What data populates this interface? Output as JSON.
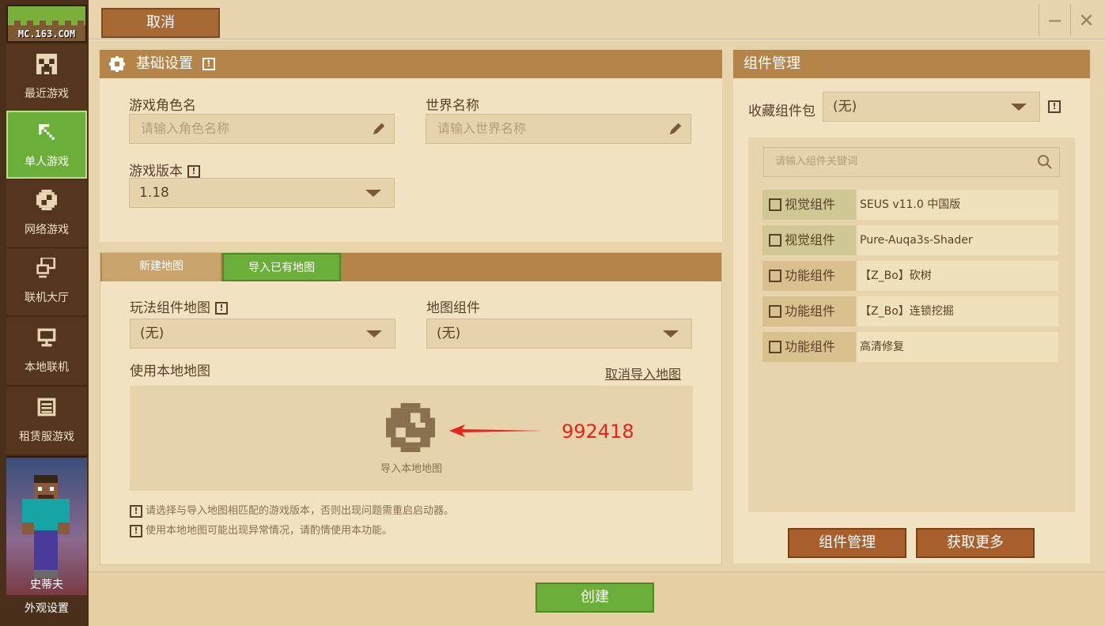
{
  "logo": {
    "text": "MC.163.COM"
  },
  "sidebar": {
    "items": [
      {
        "label": "最近游戏",
        "icon": "creeper-icon"
      },
      {
        "label": "单人游戏",
        "icon": "pickaxe-icon",
        "active": true
      },
      {
        "label": "网络游戏",
        "icon": "globe-icon"
      },
      {
        "label": "联机大厅",
        "icon": "network-icon"
      },
      {
        "label": "本地联机",
        "icon": "monitor-icon"
      },
      {
        "label": "租赁服游戏",
        "icon": "server-list-icon"
      }
    ],
    "avatar_name": "史蒂夫",
    "appearance_label": "外观设置"
  },
  "topbar": {
    "cancel_label": "取消",
    "minimize": "−",
    "close": "✕"
  },
  "basic": {
    "title": "基础设置",
    "info_mark": "!",
    "role_label": "游戏角色名",
    "role_placeholder": "请输入角色名称",
    "world_label": "世界名称",
    "world_placeholder": "请输入世界名称",
    "version_label": "游戏版本",
    "version_value": "1.18"
  },
  "map": {
    "tab_new": "新建地图",
    "tab_import": "导入已有地图",
    "gameplay_label": "玩法组件地图",
    "gameplay_value": "(无)",
    "mapcomp_label": "地图组件",
    "mapcomp_value": "(无)",
    "local_label": "使用本地地图",
    "cancel_import": "取消导入地图",
    "import_local": "导入本地地图",
    "annotation": "992418",
    "tip1": "请选择与导入地图相匹配的游戏版本，否则出现问题需重启启动器。",
    "tip2": "使用本地地图可能出现异常情况，请酌情使用本功能。"
  },
  "components": {
    "title": "组件管理",
    "fav_label": "收藏组件包",
    "fav_value": "(无)",
    "search_placeholder": "请输入组件关键词",
    "rows": [
      {
        "type": "视觉组件",
        "name": "SEUS v11.0 中国版",
        "visual": true
      },
      {
        "type": "视觉组件",
        "name": "Pure-Auqa3s-Shader",
        "visual": true
      },
      {
        "type": "功能组件",
        "name": "【Z_Bo】砍树",
        "visual": false
      },
      {
        "type": "功能组件",
        "name": "【Z_Bo】连锁挖掘",
        "visual": false
      },
      {
        "type": "功能组件",
        "name": "高清修复",
        "visual": false
      }
    ],
    "manage_btn": "组件管理",
    "more_btn": "获取更多"
  },
  "footer": {
    "create_label": "创建"
  },
  "colors": {
    "accent_green": "#6cae3a",
    "brand_brown": "#a86a35",
    "header_brown": "#b58448",
    "annotation_red": "#e8231c"
  }
}
